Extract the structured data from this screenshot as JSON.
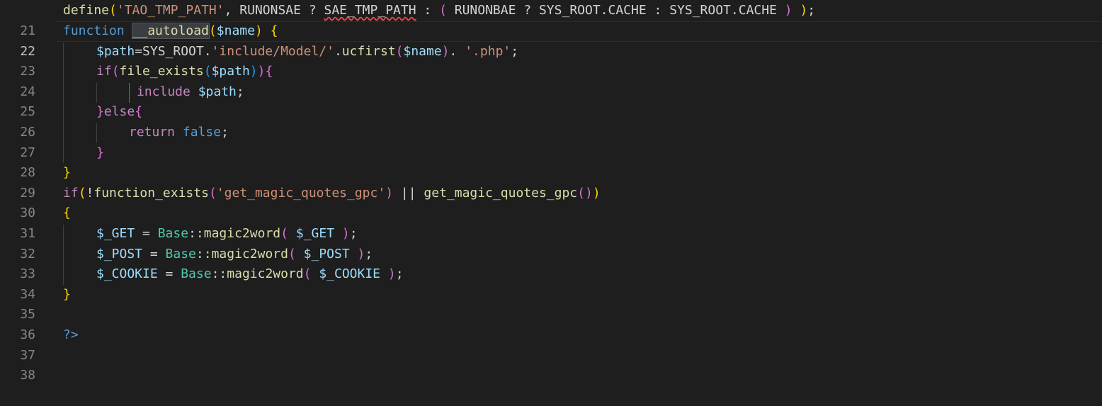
{
  "editor": {
    "line_numbers": [
      "21",
      "22",
      "23",
      "24",
      "25",
      "26",
      "27",
      "28",
      "29",
      "30",
      "31",
      "32",
      "33",
      "34",
      "35",
      "36",
      "37",
      "38"
    ],
    "current_line": "22"
  },
  "code": {
    "l21": {
      "define": "define",
      "paren_open": "(",
      "arg1": "'TAO_TMP_PATH'",
      "comma": ", ",
      "runonsae": "RUNONSAE",
      "q1": " ? ",
      "sae_tmp_path": "SAE_TMP_PATH",
      "colon1": " : ",
      "paren2_open": "(",
      "space1": " ",
      "runonbae": "RUNONBAE",
      "q2": " ? ",
      "sys_root_cache1": "SYS_ROOT.CACHE",
      "colon2": " : ",
      "sys_root_cache2": "SYS_ROOT.CACHE",
      "space2": " ",
      "paren2_close": ")",
      "space3": " ",
      "paren_close": ")",
      "semi": ";"
    },
    "l22": {
      "function_kw": "function",
      "space": " ",
      "fname": "__autoload",
      "paren_open": "(",
      "param": "$name",
      "paren_close": ")",
      "space2": " ",
      "brace": "{"
    },
    "l23": {
      "var": "$path",
      "assign": "=SYS_ROOT.",
      "str1": "'include/Model/'",
      "dot": ".",
      "ucfirst": "ucfirst",
      "paren_open": "(",
      "arg": "$name",
      "paren_close": ")",
      "dot2": ". ",
      "str2": "'.php'",
      "semi": ";"
    },
    "l24": {
      "if_kw": "if",
      "paren_open": "(",
      "fe": "file_exists",
      "paren2_open": "(",
      "arg": "$path",
      "paren2_close": ")",
      "paren_close": ")",
      "brace": "{"
    },
    "l25": {
      "include_kw": "include",
      "space": " ",
      "arg": "$path",
      "semi": ";"
    },
    "l26": {
      "brace_close": "}",
      "else_kw": "else",
      "brace_open": "{"
    },
    "l27": {
      "return_kw": "return",
      "space": " ",
      "false_kw": "false",
      "semi": ";"
    },
    "l28": {
      "brace": "}"
    },
    "l29": {
      "brace": "}"
    },
    "l30": {
      "if_kw": "if",
      "paren_open": "(",
      "not": "!",
      "fe": "function_exists",
      "paren2_open": "(",
      "str": "'get_magic_quotes_gpc'",
      "paren2_close": ")",
      "or": " || ",
      "gmq": "get_magic_quotes_gpc",
      "paren3_open": "(",
      "paren3_close": ")",
      "paren_close": ")"
    },
    "l31": {
      "brace": "{"
    },
    "l32": {
      "var": "$_GET",
      "eq": " = ",
      "cls": "Base",
      "dcolon": "::",
      "method": "magic2word",
      "paren_open": "(",
      "space1": " ",
      "arg": "$_GET",
      "space2": " ",
      "paren_close": ")",
      "semi": ";"
    },
    "l33": {
      "var": "$_POST",
      "eq": " = ",
      "cls": "Base",
      "dcolon": "::",
      "method": "magic2word",
      "paren_open": "(",
      "space1": " ",
      "arg": "$_POST",
      "space2": " ",
      "paren_close": ")",
      "semi": ";"
    },
    "l34": {
      "var": "$_COOKIE",
      "eq": " = ",
      "cls": "Base",
      "dcolon": "::",
      "method": "magic2word",
      "paren_open": "(",
      "space1": " ",
      "arg": "$_COOKIE",
      "space2": " ",
      "paren_close": ")",
      "semi": ";"
    },
    "l35": {
      "brace": "}"
    },
    "l37": {
      "close_tag": "?>"
    }
  }
}
